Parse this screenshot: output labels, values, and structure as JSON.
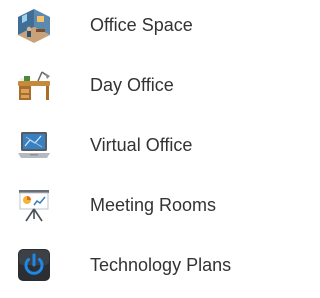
{
  "menu": {
    "items": [
      {
        "label": "Office Space",
        "icon": "office-space-icon"
      },
      {
        "label": "Day Office",
        "icon": "desk-lamp-icon"
      },
      {
        "label": "Virtual Office",
        "icon": "laptop-icon"
      },
      {
        "label": "Meeting Rooms",
        "icon": "presentation-board-icon"
      },
      {
        "label": "Technology Plans",
        "icon": "power-button-icon"
      }
    ]
  },
  "colors": {
    "label_text": "#333333",
    "background": "#ffffff",
    "office_room_blue": "#3f6f96",
    "desk_wood": "#c68a3c",
    "laptop_screen": "#3a7fc0",
    "board_chart": "#f2b632",
    "power_blue": "#1e88e5"
  }
}
